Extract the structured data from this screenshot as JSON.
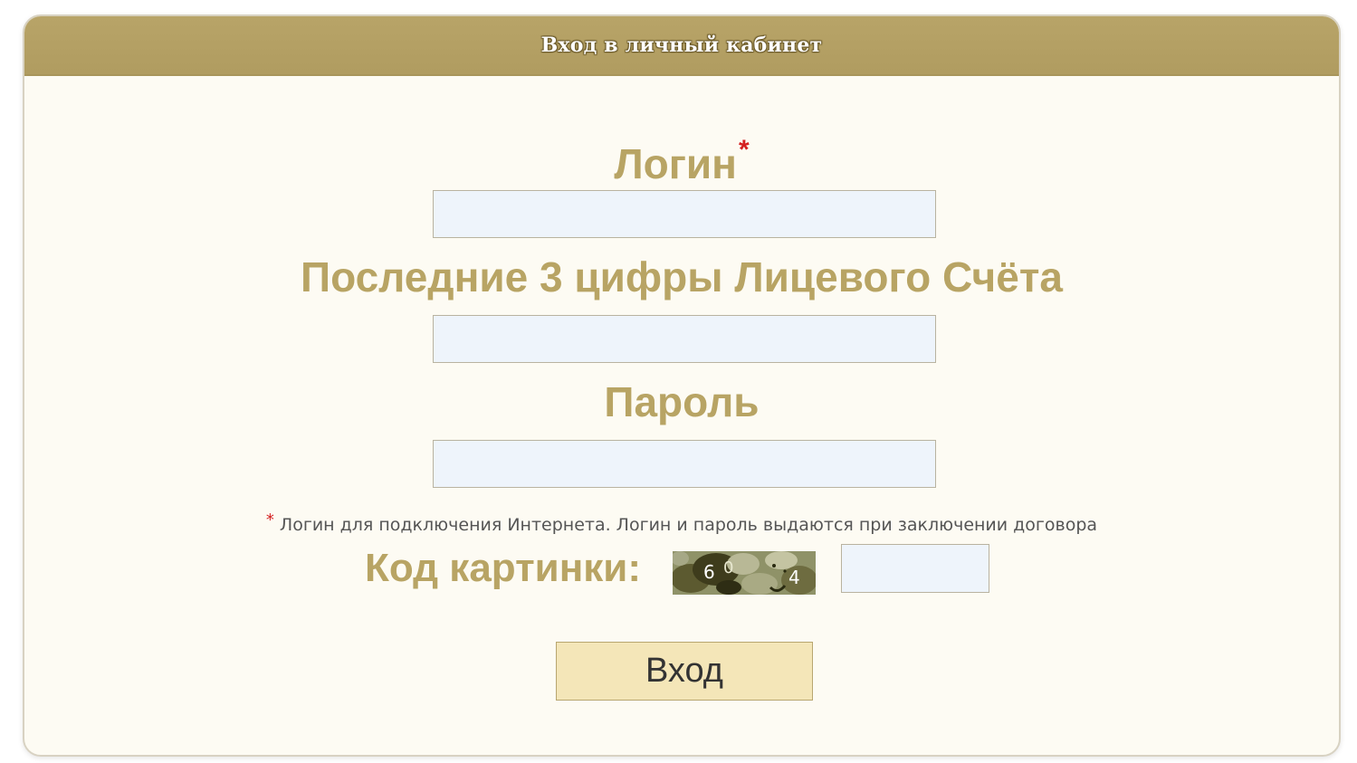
{
  "header": {
    "title": "Вход в личный кабинет"
  },
  "form": {
    "login_label": "Логин",
    "login_required_mark": "*",
    "login_value": "",
    "account_digits_label": "Последние 3 цифры Лицевого Счёта",
    "account_digits_value": "",
    "password_label": "Пароль",
    "password_value": "",
    "note_star": "*",
    "note_text": "Логин для подключения Интернета. Логин и пароль выдаются при заключении договора",
    "captcha_label": "Код картинки:",
    "captcha_chars": [
      "6",
      "0",
      "4"
    ],
    "captcha_value": "",
    "submit_label": "Вход"
  },
  "colors": {
    "header_bg": "#b8a468",
    "label_text": "#b8a464",
    "panel_bg": "#fdfbf3",
    "input_bg": "#eef4fb",
    "button_bg": "#f4e6b8",
    "required_star": "#d42020"
  }
}
